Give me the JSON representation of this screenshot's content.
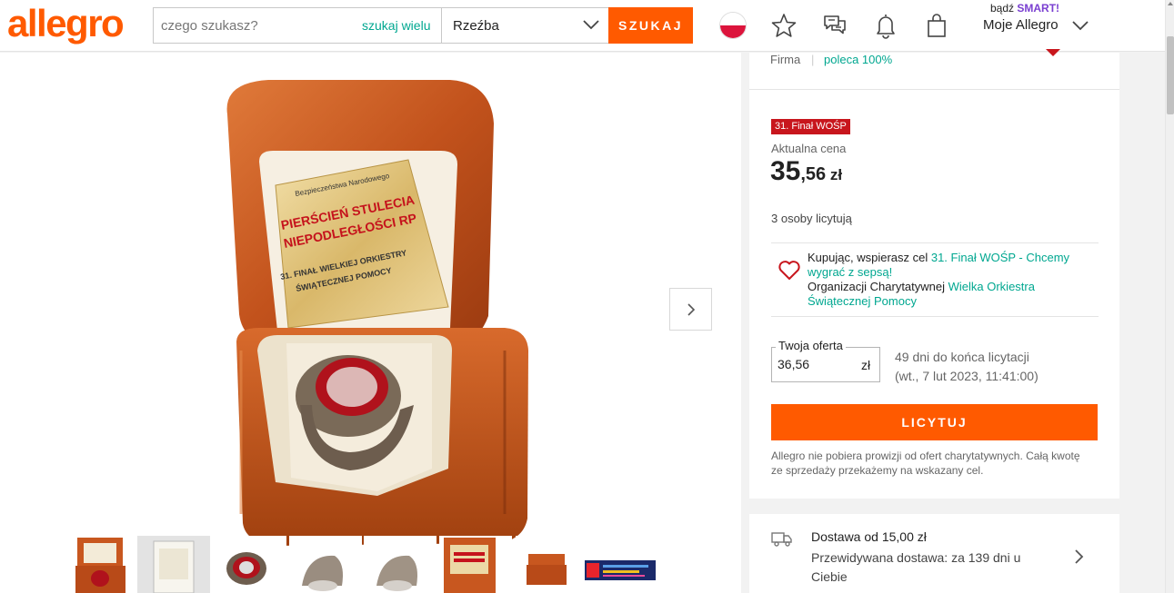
{
  "header": {
    "logo": "allegro",
    "search_placeholder": "czego szukasz?",
    "search_many": "szukaj wielu",
    "category": "Rzeźba",
    "search_button": "SZUKAJ",
    "smart_prefix": "bądź",
    "smart_label": "SMART!",
    "account_label": "Moje Allegro"
  },
  "product_image": {
    "plate_line1": "Bezpieczeństwa Narodowego",
    "plate_line2": "PIERŚCIEŃ STULECIA",
    "plate_line3": "NIEPODLEGŁOŚCI RP",
    "plate_line4": "31. FINAŁ WIELKIEJ ORKIESTRY",
    "plate_line5": "ŚWIĄTECZNEJ POMOCY"
  },
  "seller": {
    "type": "Firma",
    "separator": "|",
    "recommend": "poleca 100%"
  },
  "offer": {
    "badge": "31. Finał WOŚP",
    "price_label": "Aktualna cena",
    "price_int": "35",
    "price_frac": ",56",
    "price_currency": " zł",
    "bidders": "3 osoby licytują",
    "charity_prefix": "Kupując, wspierasz cel ",
    "charity_goal": "31. Finał WOŚP - Chcemy wygrać z sepsą!",
    "charity_org_prefix": "Organizacji Charytatywnej ",
    "charity_org": "Wielka Orkiestra Świątecznej Pomocy",
    "bid_label": "Twoja oferta",
    "bid_value": "36,56",
    "bid_currency": "zł",
    "time_left": "49 dni do końca licytacji",
    "end_date": "(wt., 7 lut 2023, 11:41:00)",
    "bid_button": "LICYTUJ",
    "note": "Allegro nie pobiera prowizji od ofert charytatywnych. Całą kwotę ze sprzedaży przekażemy na wskazany cel."
  },
  "delivery": {
    "title": "Dostawa od 15,00 zł",
    "estimate": "Przewidywana dostawa: za 139 dni u Ciebie"
  },
  "colors": {
    "brand": "#ff5a00",
    "teal": "#00a790",
    "badge_red": "#c8161d",
    "wood": "#c8571f"
  }
}
